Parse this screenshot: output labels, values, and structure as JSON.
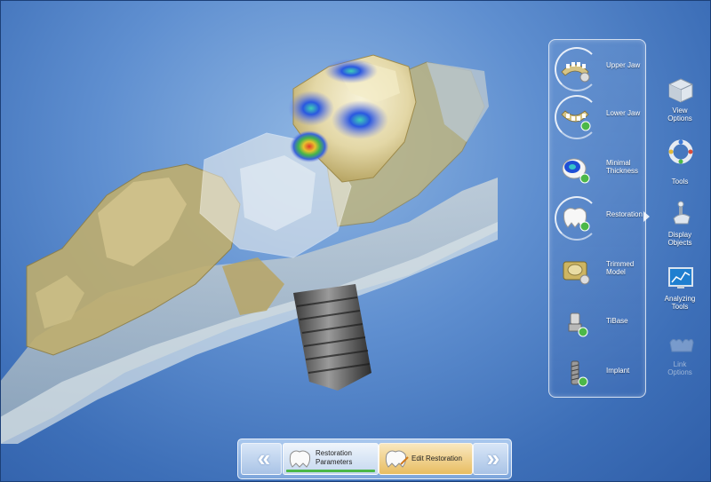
{
  "object_list": {
    "items": [
      {
        "id": "upper_jaw",
        "label": "Upper Jaw",
        "icon": "upper-jaw-icon"
      },
      {
        "id": "lower_jaw",
        "label": "Lower Jaw",
        "icon": "lower-jaw-icon"
      },
      {
        "id": "minimal_thickness",
        "label": "Minimal Thickness",
        "icon": "minimal-thickness-icon"
      },
      {
        "id": "restoration",
        "label": "Restoration",
        "icon": "restoration-icon"
      },
      {
        "id": "trimmed_model",
        "label": "Trimmed Model",
        "icon": "trimmed-model-icon"
      },
      {
        "id": "tibase",
        "label": "TiBase",
        "icon": "tibase-icon"
      },
      {
        "id": "implant",
        "label": "Implant",
        "icon": "implant-icon"
      }
    ]
  },
  "toolbar": {
    "items": [
      {
        "id": "view_options",
        "label_line1": "View",
        "label_line2": "Options",
        "icon": "cube-icon",
        "enabled": true
      },
      {
        "id": "tools",
        "label_line1": "Tools",
        "label_line2": "",
        "icon": "tools-ring-icon",
        "enabled": true
      },
      {
        "id": "display_objects",
        "label_line1": "Display",
        "label_line2": "Objects",
        "icon": "display-objects-icon",
        "enabled": true
      },
      {
        "id": "analyzing_tools",
        "label_line1": "Analyzing",
        "label_line2": "Tools",
        "icon": "analyzing-chart-icon",
        "enabled": true
      },
      {
        "id": "link_options",
        "label_line1": "Link",
        "label_line2": "Options",
        "icon": "link-teeth-icon",
        "enabled": false
      }
    ]
  },
  "step_bar": {
    "prev_label": "«",
    "next_label": "»",
    "steps": [
      {
        "id": "restoration_parameters",
        "label_line1": "Restoration",
        "label_line2": "Parameters",
        "state": "completed"
      },
      {
        "id": "edit_restoration",
        "label_line1": "Edit Restoration",
        "label_line2": "",
        "state": "active"
      }
    ]
  },
  "colors": {
    "background": "#5f8fd0",
    "panel_border": "#ffffff",
    "active_step": "#e8bd62",
    "progress_green": "#4cb848",
    "model_tan": "#c8b77a",
    "tissue_gray": "#b9c6cf"
  }
}
